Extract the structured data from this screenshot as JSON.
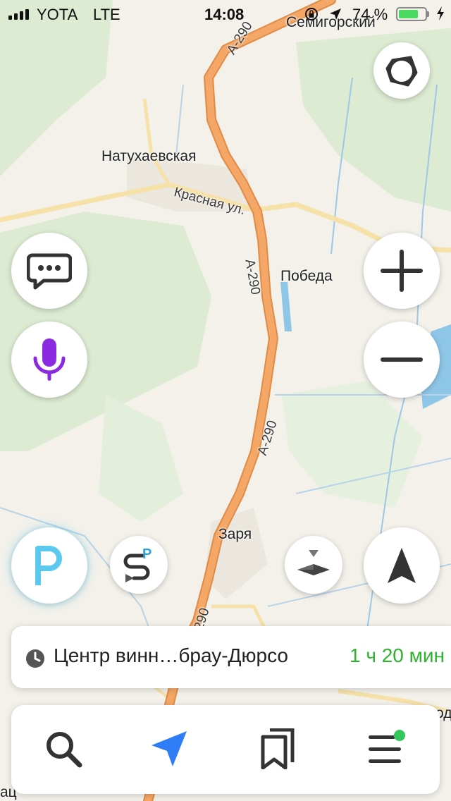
{
  "status_bar": {
    "carrier": "YOTA",
    "network": "LTE",
    "time": "14:08",
    "battery_text": "74 %",
    "battery_level": 0.74,
    "battery_color": "#4cd964",
    "signal_bars": 4,
    "icons": [
      "orientation-lock-icon",
      "location-arrow-icon",
      "charging-bolt-icon"
    ]
  },
  "map": {
    "places": {
      "semigorsky": "Семигорский",
      "natukhaevskaya": "Натухаевская",
      "pobeda": "Победа",
      "zarya": "Заря",
      "edge_right": "од",
      "edge_left": "ац"
    },
    "streets": {
      "krasnaya": "Красная ул."
    },
    "road_shields": {
      "a290": "A-290"
    },
    "colors": {
      "land": "#f3f1ea",
      "forest": "#dcebd2",
      "highway": "#f4a766",
      "minor_road": "#f6e2a8",
      "water": "#8ec6e8"
    }
  },
  "controls": {
    "alice_icon": "alice-assistant-icon",
    "chat_icon": "chat-bubble-icon",
    "voice_icon": "microphone-icon",
    "zoom_in_icon": "plus-icon",
    "zoom_out_icon": "minus-icon",
    "parking_icon": "parking-icon",
    "parking_route_icon": "parking-route-icon",
    "compass_icon": "compass-icon",
    "locate_icon": "navigation-arrow-icon",
    "accent_purple": "#8a2be2",
    "accent_parking": "#5bc8f0"
  },
  "route_card": {
    "destination": "Центр винн…брау-Дюрсо",
    "eta": "1 ч 20 мин",
    "eta_color": "#2fb32f"
  },
  "tab_bar": {
    "tabs": [
      {
        "name": "search",
        "icon": "search-icon"
      },
      {
        "name": "navigator",
        "icon": "navigation-arrow-icon"
      },
      {
        "name": "bookmarks",
        "icon": "bookmarks-icon"
      },
      {
        "name": "menu",
        "icon": "menu-icon",
        "has_notification": true
      }
    ],
    "notification_color": "#34c759"
  }
}
